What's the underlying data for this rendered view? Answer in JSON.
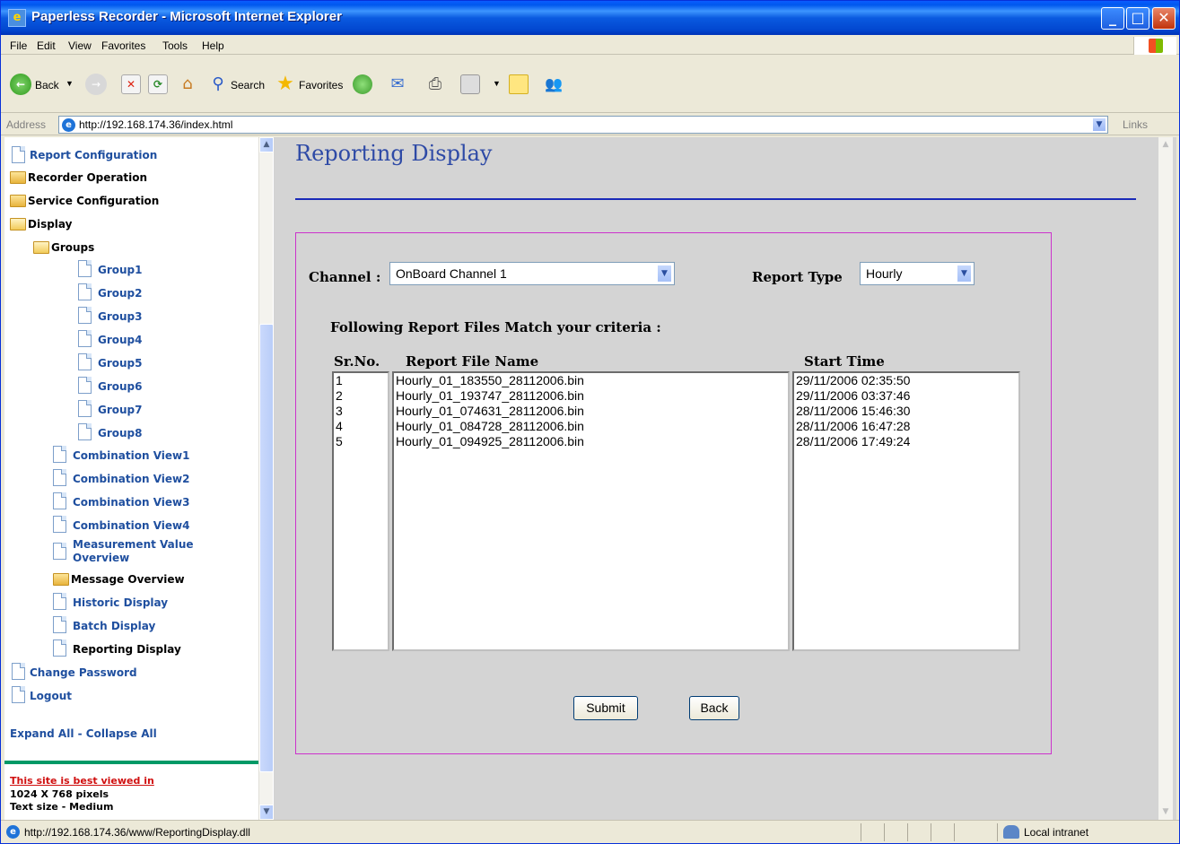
{
  "window": {
    "title": "Paperless Recorder - Microsoft Internet Explorer"
  },
  "menu": [
    "File",
    "Edit",
    "View",
    "Favorites",
    "Tools",
    "Help"
  ],
  "toolbar": {
    "back": "Back",
    "search": "Search",
    "favorites": "Favorites"
  },
  "address": {
    "label": "Address",
    "url": "http://192.168.174.36/index.html",
    "links": "Links"
  },
  "sidebar": {
    "items": [
      {
        "label": "Report Configuration"
      },
      {
        "label": "Recorder Operation"
      },
      {
        "label": "Service Configuration"
      },
      {
        "label": "Display"
      },
      {
        "label": "Groups"
      },
      {
        "label": "Group1"
      },
      {
        "label": "Group2"
      },
      {
        "label": "Group3"
      },
      {
        "label": "Group4"
      },
      {
        "label": "Group5"
      },
      {
        "label": "Group6"
      },
      {
        "label": "Group7"
      },
      {
        "label": "Group8"
      },
      {
        "label": "Combination View1"
      },
      {
        "label": "Combination View2"
      },
      {
        "label": "Combination View3"
      },
      {
        "label": "Combination View4"
      },
      {
        "label": "Measurement Value"
      },
      {
        "label": "Overview"
      },
      {
        "label": "Message Overview"
      },
      {
        "label": "Historic Display"
      },
      {
        "label": "Batch Display"
      },
      {
        "label": "Reporting Display"
      },
      {
        "label": "Change Password"
      },
      {
        "label": "Logout"
      }
    ],
    "expand_collapse": "Expand All - Collapse All",
    "best_viewed": "This site is best viewed in",
    "resolution": "1024 X 768 pixels",
    "text_size": "Text size - Medium"
  },
  "main": {
    "title": "Reporting Display",
    "channel_label": "Channel :",
    "channel_value": "OnBoard Channel 1",
    "report_type_label": "Report Type",
    "report_type_value": "Hourly",
    "criteria_text": "Following Report Files Match your criteria :",
    "col_srno": "Sr.No.",
    "col_name": "Report File  Name",
    "col_start": "Start Time",
    "rows": [
      {
        "sr": "1",
        "name": "Hourly_01_183550_28112006.bin",
        "start": "29/11/2006 02:35:50"
      },
      {
        "sr": "2",
        "name": "Hourly_01_193747_28112006.bin",
        "start": "29/11/2006 03:37:46"
      },
      {
        "sr": "3",
        "name": "Hourly_01_074631_28112006.bin",
        "start": "28/11/2006 15:46:30"
      },
      {
        "sr": "4",
        "name": "Hourly_01_084728_28112006.bin",
        "start": "28/11/2006 16:47:28"
      },
      {
        "sr": "5",
        "name": "Hourly_01_094925_28112006.bin",
        "start": "28/11/2006 17:49:24"
      }
    ],
    "submit": "Submit",
    "back": "Back"
  },
  "status": {
    "url": "http://192.168.174.36/www/ReportingDisplay.dll",
    "zone": "Local intranet"
  }
}
